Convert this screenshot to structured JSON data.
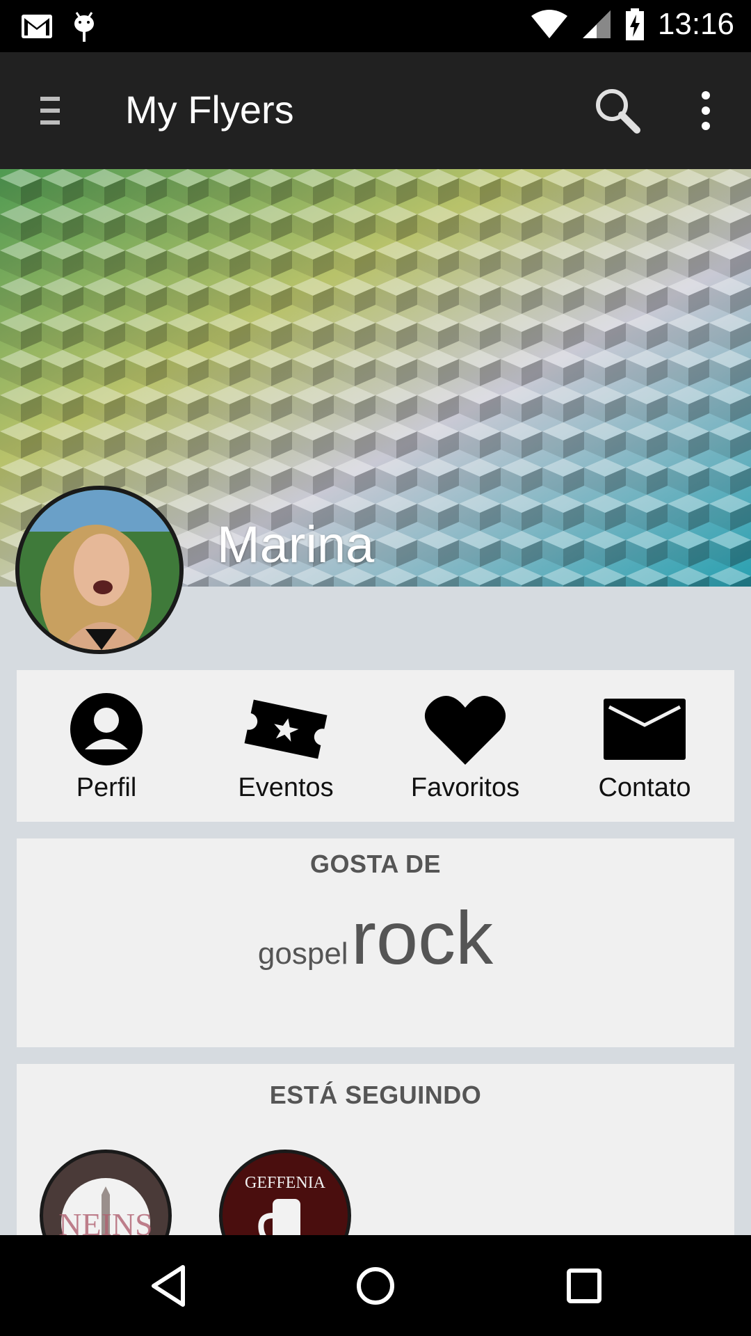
{
  "status_bar": {
    "time": "13:16",
    "icons": [
      "gmail-icon",
      "android-debug-icon",
      "wifi-icon",
      "signal-icon",
      "battery-charging-icon"
    ]
  },
  "app_bar": {
    "title": "My Flyers",
    "menu_icon": "menu-icon",
    "search_icon": "search-icon",
    "overflow_icon": "more-vert-icon"
  },
  "profile": {
    "name": "Marina"
  },
  "nav": {
    "items": [
      {
        "label": "Perfil",
        "icon": "person-icon"
      },
      {
        "label": "Eventos",
        "icon": "ticket-icon"
      },
      {
        "label": "Favoritos",
        "icon": "heart-icon"
      },
      {
        "label": "Contato",
        "icon": "mail-icon"
      }
    ]
  },
  "likes": {
    "heading": "GOSTA DE",
    "tags": [
      "gospel",
      "rock"
    ]
  },
  "following": {
    "heading": "ESTÁ SEGUINDO",
    "items": [
      {
        "label": "NEINS"
      },
      {
        "label": "GEFFENIA"
      }
    ]
  },
  "system_nav": {
    "icons": [
      "back-icon",
      "home-icon",
      "recents-icon"
    ]
  },
  "colors": {
    "app_bar": "#212121",
    "background": "#d6dbe0",
    "card": "#f0f0f0",
    "heading_text": "#555555"
  }
}
